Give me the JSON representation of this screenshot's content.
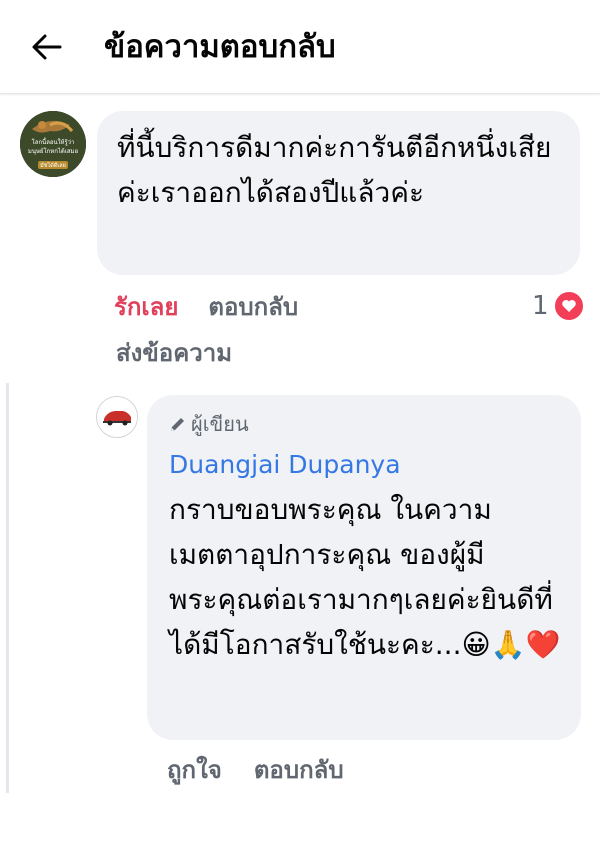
{
  "header": {
    "title": "ข้อความตอบกลับ"
  },
  "comment": {
    "text": "ที่นี้บริการดีมากค่ะการันตีอีกหนึ่งเสียค่ะเราออกได้สองปีแล้วค่ะ",
    "avatar_text_1": "โลกนี้ลอนให้รู้ว่า",
    "avatar_text_2": "มนุษย์โกหกได้เสมอ",
    "avatar_text_3": "มัชได้ดีเลย",
    "love_label": "รักเลย",
    "reply_label": "ตอบกลับ",
    "send_label": "ส่งข้อความ",
    "reaction_count": "1"
  },
  "reply": {
    "badge": "ผู้เขียน",
    "author": "Duangjai Dupanya",
    "text": "กราบขอบพระคุณ ในความเมตตาอุปการะคุณ ของผู้มีพระคุณต่อเรามากๆเลยค่ะยินดีที่ได้มีโอกาสรับใช้นะคะ...😀🙏❤️",
    "like_label": "ถูกใจ",
    "reply_label": "ตอบกลับ"
  },
  "colors": {
    "love": "#e0405a",
    "author_link": "#3578e5",
    "bubble": "#f0f2f5"
  }
}
